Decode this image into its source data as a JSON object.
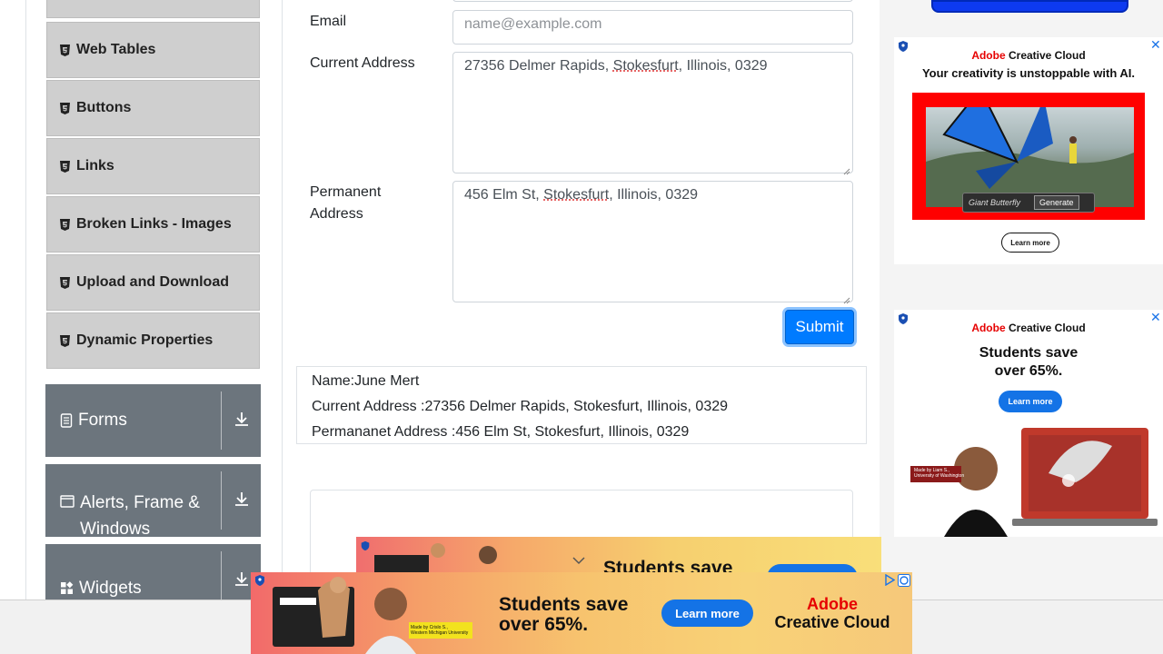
{
  "sidebar": {
    "items": [
      {
        "label": "Web Tables"
      },
      {
        "label": "Buttons"
      },
      {
        "label": "Links"
      },
      {
        "label": "Broken Links - Images"
      },
      {
        "label": "Upload and Download"
      },
      {
        "label": "Dynamic Properties"
      }
    ],
    "groups": [
      {
        "label": "Forms"
      },
      {
        "label": "Alerts, Frame & Windows"
      },
      {
        "label": "Widgets"
      }
    ]
  },
  "form": {
    "email_label": "Email",
    "email_placeholder": "name@example.com",
    "current_address_label": "Current Address",
    "current_address_value_a": "27356 Delmer Rapids, ",
    "current_address_value_b": "Stokesfurt",
    "current_address_value_c": ", Illinois, 0329",
    "permanent_address_label_1": "Permanent",
    "permanent_address_label_2": "Address",
    "permanent_address_value_a": "456 Elm St, ",
    "permanent_address_value_b": "Stokesfurt",
    "permanent_address_value_c": ", Illinois, 0329",
    "submit_label": "Submit"
  },
  "output": {
    "name": "Name:June Mert",
    "current": "Current Address :27356 Delmer Rapids, Stokesfurt, Illinois, 0329",
    "permanent": "Permananet Address :456 Elm St, Stokesfurt, Illinois, 0329"
  },
  "ads": {
    "ad1": {
      "brand_a": "Adobe",
      "brand_b": " Creative Cloud",
      "headline": "Your creativity is unstoppable with AI.",
      "chip_text": "Giant Butterfly",
      "generate": "Generate",
      "learn_more": "Learn more"
    },
    "ad2": {
      "brand_a": "Adobe",
      "brand_b": " Creative Cloud",
      "headline_1": "Students save",
      "headline_2": "over 65%.",
      "learn_more": "Learn more",
      "caption_1": "Made by Liam S.,",
      "caption_2": "University of Washington"
    },
    "banner_back": {
      "headline": "Students save"
    },
    "banner_front": {
      "headline_1": "Students save",
      "headline_2": "over 65%.",
      "learn_more": "Learn more",
      "brand_1": "Adobe",
      "brand_2": "Creative Cloud",
      "caption_1": "Made by Crislo S.,",
      "caption_2": "Western Michigan University"
    },
    "accent": "#1473e6",
    "brand_red": "#e60000"
  }
}
